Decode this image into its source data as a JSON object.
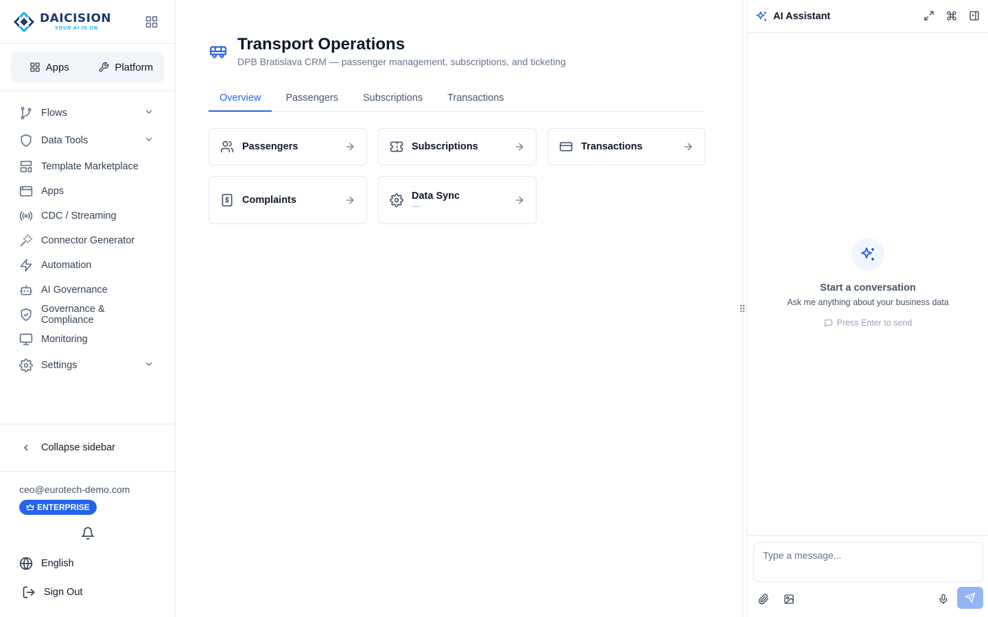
{
  "brand": {
    "name": "DAICISION",
    "tagline": "YOUR AI IS ON"
  },
  "switcher": {
    "apps_label": "Apps",
    "platform_label": "Platform"
  },
  "nav": {
    "flows": "Flows",
    "data_tools": "Data Tools",
    "template_marketplace": "Template Marketplace",
    "apps": "Apps",
    "cdc_streaming": "CDC / Streaming",
    "connector_generator": "Connector Generator",
    "automation": "Automation",
    "ai_governance": "AI Governance",
    "governance_compliance": "Governance & Compliance",
    "monitoring": "Monitoring",
    "settings": "Settings"
  },
  "sidebar_footer": {
    "collapse_label": "Collapse sidebar",
    "user_email": "ceo@eurotech-demo.com",
    "plan_badge": "ENTERPRISE",
    "language": "English",
    "sign_out": "Sign Out"
  },
  "page": {
    "title": "Transport Operations",
    "subtitle": "DPB Bratislava CRM — passenger management, subscriptions, and ticketing"
  },
  "tabs": [
    "Overview",
    "Passengers",
    "Subscriptions",
    "Transactions"
  ],
  "active_tab": "Overview",
  "cards": {
    "passengers": "Passengers",
    "subscriptions": "Subscriptions",
    "transactions": "Transactions",
    "complaints": "Complaints",
    "data_sync": "Data Sync",
    "data_sync_status": "—"
  },
  "assistant": {
    "title": "AI Assistant",
    "empty_title": "Start a conversation",
    "empty_subtitle": "Ask me anything about your business data",
    "hint": "Press Enter to send",
    "input_placeholder": "Type a message..."
  },
  "colors": {
    "accent": "#2563eb",
    "send_disabled": "#93b4f5"
  }
}
